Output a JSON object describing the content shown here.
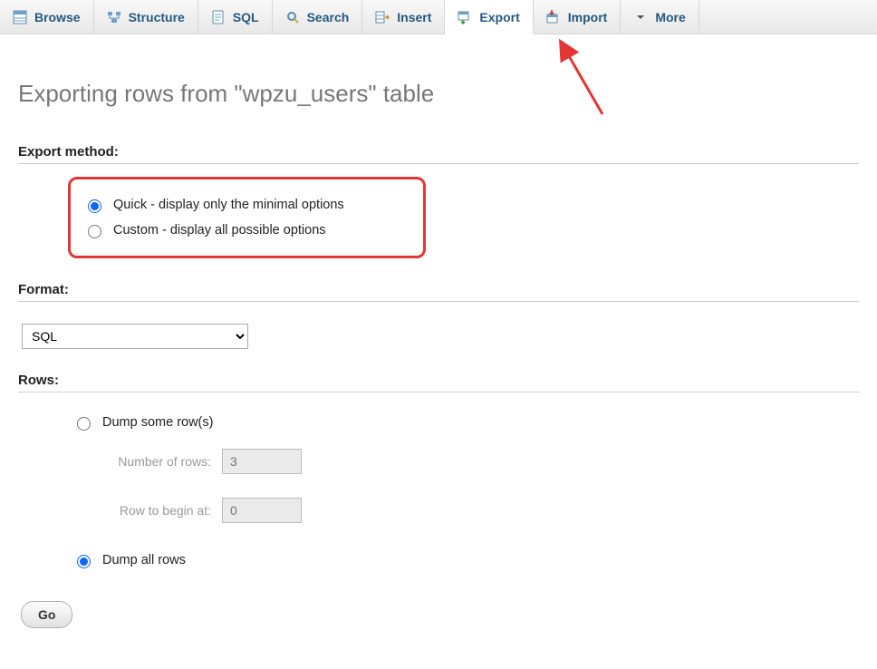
{
  "tabs": [
    {
      "id": "browse",
      "label": "Browse"
    },
    {
      "id": "structure",
      "label": "Structure"
    },
    {
      "id": "sql",
      "label": "SQL"
    },
    {
      "id": "search",
      "label": "Search"
    },
    {
      "id": "insert",
      "label": "Insert"
    },
    {
      "id": "export",
      "label": "Export"
    },
    {
      "id": "import",
      "label": "Import"
    },
    {
      "id": "more",
      "label": "More"
    }
  ],
  "active_tab": "export",
  "page_title": "Exporting rows from \"wpzu_users\" table",
  "sections": {
    "export_method_label": "Export method:",
    "format_label": "Format:",
    "rows_label": "Rows:"
  },
  "export_method": {
    "quick": "Quick - display only the minimal options",
    "custom": "Custom - display all possible options",
    "selected": "quick"
  },
  "format": {
    "selected": "SQL",
    "options": [
      "SQL"
    ]
  },
  "rows": {
    "dump_some_label": "Dump some row(s)",
    "dump_all_label": "Dump all rows",
    "selected": "all",
    "num_rows_label": "Number of rows:",
    "num_rows_value": "3",
    "begin_at_label": "Row to begin at:",
    "begin_at_value": "0"
  },
  "go_button": "Go",
  "colors": {
    "accent_red": "#e53535",
    "tab_link": "#235a81"
  }
}
